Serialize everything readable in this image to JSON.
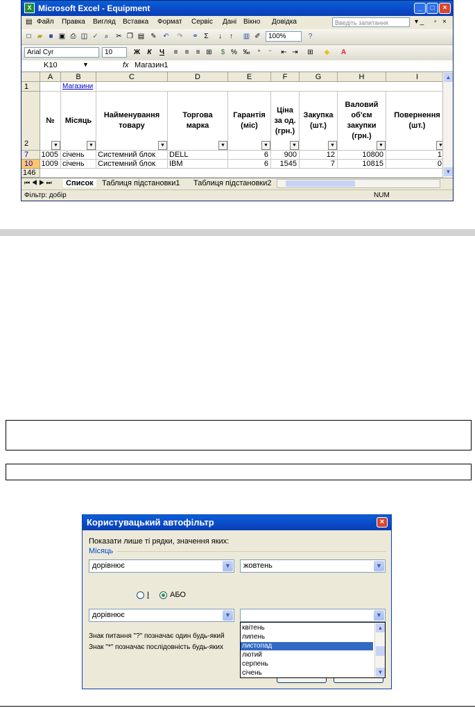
{
  "excel": {
    "title": "Microsoft Excel - Equipment",
    "window_buttons": {
      "minimize": "_",
      "maximize": "□",
      "close": "×"
    },
    "menu": [
      "Файл",
      "Правка",
      "Вигляд",
      "Вставка",
      "Формат",
      "Сервіс",
      "Дані",
      "Вікно",
      "Довідка"
    ],
    "help_placeholder": "Введіть запитання",
    "zoom": "100%",
    "font_name": "Arial Cyr",
    "font_size": "10",
    "fmt_bold": "Ж",
    "fmt_italic": "К",
    "fmt_underline": "Ч",
    "name_box": "K10",
    "fx": "fx",
    "formula": "Магазин1",
    "columns": [
      "A",
      "B",
      "C",
      "D",
      "E",
      "F",
      "G",
      "H",
      "I"
    ],
    "row_numbers": [
      "1",
      "2",
      "7",
      "10",
      "146"
    ],
    "link_cell": "Магазини",
    "headers": [
      "№",
      "Місяць",
      "Найменування товару",
      "Торгова марка",
      "Гарантія (міс)",
      "Ціна за од. (грн.)",
      "Закупка (шт.)",
      "Валовий об'єм закупки (грн.)",
      "Повернення (шт.)"
    ],
    "rows": [
      {
        "row": "7",
        "no": "1005",
        "month": "січень",
        "name": "Системний блок",
        "brand": "DELL",
        "warranty": "6",
        "price": "900",
        "qty": "12",
        "total": "10800",
        "ret": "1"
      },
      {
        "row": "10",
        "no": "1009",
        "month": "січень",
        "name": "Системний блок",
        "brand": "IBM",
        "warranty": "6",
        "price": "1545",
        "qty": "7",
        "total": "10815",
        "ret": "0"
      }
    ],
    "sheet_tabs": [
      "Список",
      "Таблиця підстановки1",
      "Таблиця підстановки2"
    ],
    "status_left": "Фільтр: добір",
    "status_num": "NUM"
  },
  "dialog": {
    "title": "Користувацький автофільтр",
    "prompt": "Показати лише ті рядки, значення яких:",
    "field": "Місяць",
    "op1": "дорівнює",
    "val1": "жовтень",
    "radio_and": "І",
    "radio_or": "АБО",
    "op2": "дорівнює",
    "val2": "",
    "hint1": "Знак питання \"?\" позначає один будь-який",
    "hint2": "Знак \"*\" позначає послідовність будь-яких",
    "list": [
      "квітень",
      "липень",
      "листопад",
      "лютий",
      "серпень",
      "січень"
    ],
    "list_selected": "листопад"
  }
}
